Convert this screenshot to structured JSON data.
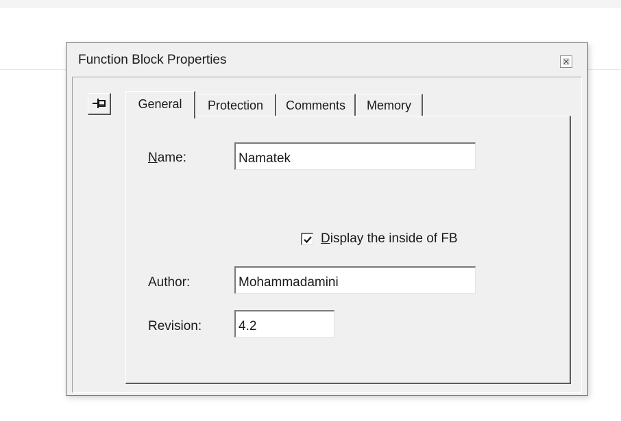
{
  "window": {
    "title": "Function Block Properties",
    "close_icon": "close-icon"
  },
  "pin_button": {
    "icon": "pushpin-icon"
  },
  "tabs": [
    {
      "label": "General",
      "active": true
    },
    {
      "label": "Protection",
      "active": false
    },
    {
      "label": "Comments",
      "active": false
    },
    {
      "label": "Memory",
      "active": false
    }
  ],
  "general": {
    "name_label_first": "N",
    "name_label_rest": "ame:",
    "name_value": "Namatek",
    "display_checkbox_checked": true,
    "display_label_first": "D",
    "display_label_rest": "isplay the inside of FB",
    "author_label": "Author:",
    "author_value": "Mohammadamini",
    "revision_label": "Revision:",
    "revision_value": "4.2"
  }
}
